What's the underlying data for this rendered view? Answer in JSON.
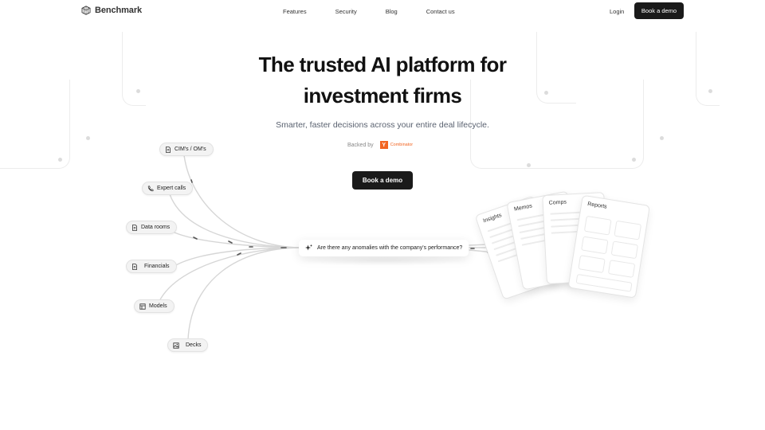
{
  "nav": {
    "brand": "Benchmark",
    "links": [
      "Features",
      "Security",
      "Blog",
      "Contact us"
    ],
    "login": "Login",
    "cta": "Book a demo"
  },
  "hero": {
    "title_line1": "The trusted AI platform for",
    "title_line2": "investment firms",
    "subtitle": "Smarter, faster decisions across your entire deal lifecycle.",
    "backed_by": "Backed by",
    "backer_logo_letter": "Y",
    "backer_name": "Combinator",
    "cta": "Book a demo"
  },
  "sources": [
    {
      "label": "CIM's / OM's",
      "icon": "document-icon"
    },
    {
      "label": "Expert calls",
      "icon": "phone-icon"
    },
    {
      "label": "Data rooms",
      "icon": "document-icon"
    },
    {
      "label": "Financials",
      "icon": "document-icon"
    },
    {
      "label": "Models",
      "icon": "table-icon"
    },
    {
      "label": "Decks",
      "icon": "image-icon"
    }
  ],
  "query": {
    "icon": "sparkle-icon",
    "text": "Are there any anomalies with the company's performance?"
  },
  "outputs": [
    "Insights",
    "Memos",
    "Comps",
    "Reports"
  ],
  "colors": {
    "primary_button": "#1a1a1a",
    "yc_orange": "#f26522",
    "subtitle": "#5a6270"
  }
}
